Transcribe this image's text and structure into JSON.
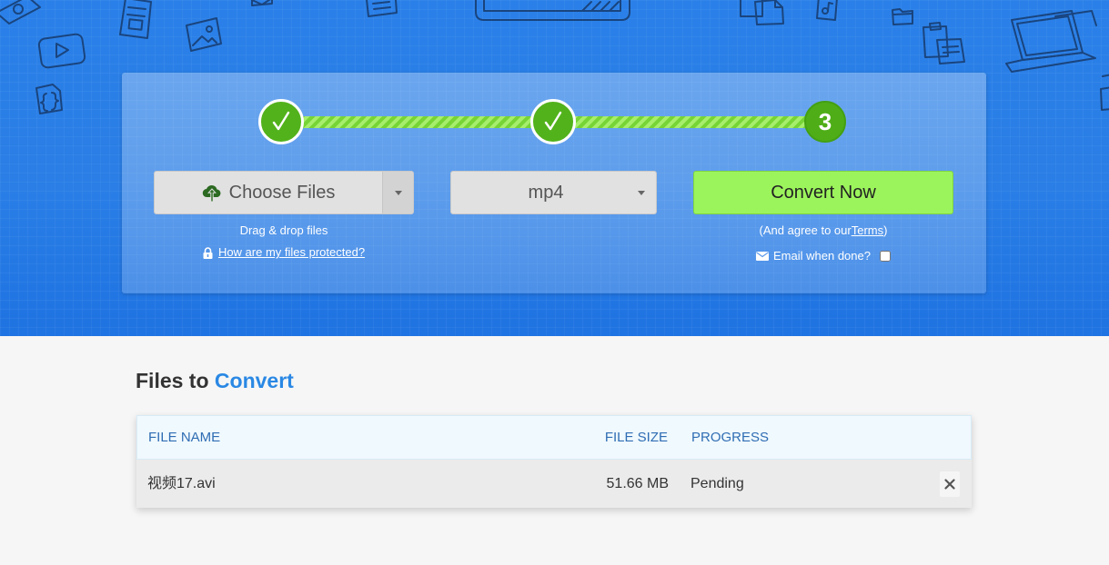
{
  "steps": [
    {
      "completed": true
    },
    {
      "completed": true
    },
    {
      "completed": false,
      "label": "3"
    }
  ],
  "upload": {
    "choose_files_label": "Choose Files",
    "drag_drop_text": "Drag & drop files",
    "protection_link": "How are my files protected?"
  },
  "format": {
    "selected": "mp4"
  },
  "convert": {
    "button_label": "Convert Now",
    "agree_prefix": "(And agree to our ",
    "terms_link": "Terms",
    "agree_suffix": ")",
    "email_label": "Email when done?",
    "email_checked": false
  },
  "files": {
    "heading_prefix": "Files to",
    "heading_accent": "Convert",
    "columns": {
      "name": "FILE NAME",
      "size": "FILE SIZE",
      "progress": "PROGRESS"
    },
    "rows": [
      {
        "name": "视频17.avi",
        "size": "51.66 MB",
        "status": "Pending"
      }
    ]
  },
  "icons": {
    "step_done": "check-icon",
    "upload": "cloud-upload-icon",
    "dropdown": "caret-down-icon",
    "protection": "lock-icon",
    "email": "envelope-icon",
    "remove_file": "close-icon"
  },
  "colors": {
    "hero_blue": "#2a7ee6",
    "step_green": "#52b21b",
    "convert_green": "#9cf45c",
    "accent_blue": "#2a88e4",
    "table_header_text": "#2f6db3"
  }
}
